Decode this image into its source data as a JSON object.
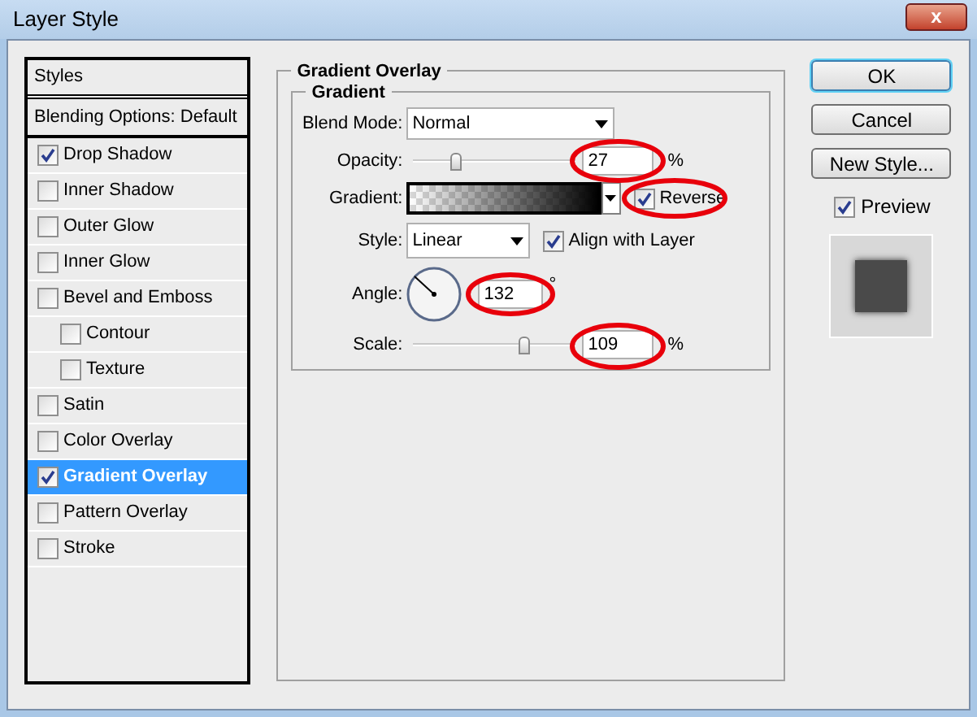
{
  "window": {
    "title": "Layer Style",
    "close_label": "x"
  },
  "sidebar": {
    "header": "Styles",
    "blending": "Blending Options: Default",
    "items": [
      {
        "label": "Drop Shadow",
        "checked": true,
        "selected": false
      },
      {
        "label": "Inner Shadow",
        "checked": false,
        "selected": false
      },
      {
        "label": "Outer Glow",
        "checked": false,
        "selected": false
      },
      {
        "label": "Inner Glow",
        "checked": false,
        "selected": false
      },
      {
        "label": "Bevel and Emboss",
        "checked": false,
        "selected": false,
        "children": [
          {
            "label": "Contour",
            "checked": false,
            "selected": false
          },
          {
            "label": "Texture",
            "checked": false,
            "selected": false
          }
        ]
      },
      {
        "label": "Satin",
        "checked": false,
        "selected": false
      },
      {
        "label": "Color Overlay",
        "checked": false,
        "selected": false
      },
      {
        "label": "Gradient Overlay",
        "checked": true,
        "selected": true
      },
      {
        "label": "Pattern Overlay",
        "checked": false,
        "selected": false
      },
      {
        "label": "Stroke",
        "checked": false,
        "selected": false
      }
    ]
  },
  "panel": {
    "title": "Gradient Overlay",
    "group": "Gradient",
    "blend_mode": {
      "label": "Blend Mode:",
      "value": "Normal"
    },
    "opacity": {
      "label": "Opacity:",
      "level": 0.26,
      "value": "27",
      "unit": "%"
    },
    "gradient": {
      "label": "Gradient:",
      "reverse": {
        "label": "Reverse",
        "checked": true
      }
    },
    "style": {
      "label": "Style:",
      "value": "Linear",
      "align": {
        "label": "Align with Layer",
        "checked": true
      }
    },
    "angle": {
      "label": "Angle:",
      "value": "132",
      "unit": "°"
    },
    "scale": {
      "label": "Scale:",
      "level": 0.68,
      "value": "109",
      "unit": "%"
    }
  },
  "buttons": [
    {
      "label": "OK",
      "default": true
    },
    {
      "label": "Cancel",
      "default": false
    },
    {
      "label": "New Style...",
      "default": false
    }
  ],
  "preview": {
    "label": "Preview",
    "checked": true
  }
}
